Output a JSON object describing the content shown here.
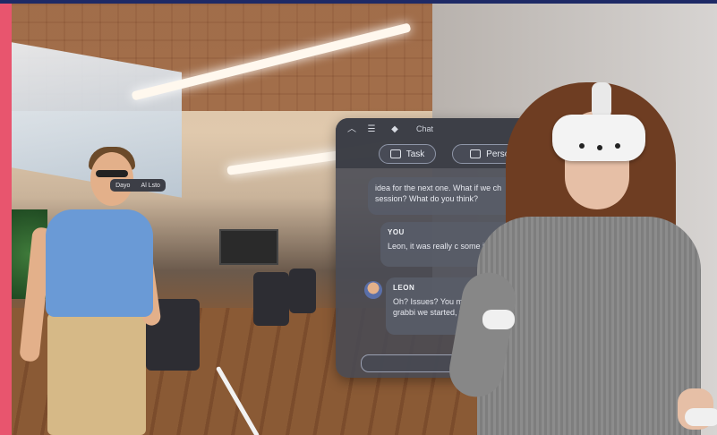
{
  "scene": {
    "avatar_tag": {
      "left": "Dayo",
      "right": "Al Lsto"
    },
    "chat_panel": {
      "header": {
        "title": "Chat",
        "icons": [
          "chevron-up-icon",
          "menu-icon",
          "chat-bubble-icon"
        ]
      },
      "buttons": [
        {
          "label": "Task",
          "icon": "task-icon"
        },
        {
          "label": "Person",
          "icon": "person-icon"
        }
      ],
      "messages": [
        {
          "sender": "",
          "text": "idea for the next one. What if we ch session? What do you think?"
        },
        {
          "sender": "YOU",
          "text": "Leon, it was really c some issues that w"
        },
        {
          "sender": "LEON",
          "text": "Oh? Issues? You mea seemed fine grabbi we started, the en"
        }
      ],
      "input_placeholder": ""
    }
  },
  "colors": {
    "left_accent": "#e8556e",
    "top_accent": "#1e2a66",
    "panel_bg": "#484a54"
  }
}
